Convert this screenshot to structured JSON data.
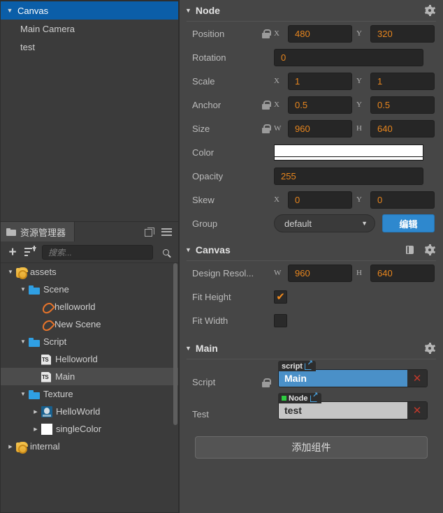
{
  "hierarchy": {
    "items": [
      {
        "label": "Canvas",
        "indent": 0,
        "arrow": "down",
        "selected": true
      },
      {
        "label": "Main Camera",
        "indent": 1,
        "arrow": "none",
        "selected": false
      },
      {
        "label": "test",
        "indent": 1,
        "arrow": "none",
        "selected": false
      }
    ]
  },
  "assets": {
    "tab_label": "资源管理器",
    "tab_icon": "folder-icon",
    "popout_icon": "popout-icon",
    "menu_icon": "hamburger-menu-icon",
    "add_label": "+",
    "sort_icon": "sort-icon",
    "search": {
      "placeholder": "搜索...",
      "value": ""
    },
    "search_icon": "search-icon",
    "tree": [
      {
        "label": "assets",
        "indent": 0,
        "arrow": "down",
        "icon": "assets-bag-icon",
        "selected": false
      },
      {
        "label": "Scene",
        "indent": 1,
        "arrow": "down",
        "icon": "folder-icon",
        "selected": false
      },
      {
        "label": "helloworld",
        "indent": 2,
        "arrow": "none",
        "icon": "scene-fire-icon",
        "selected": false
      },
      {
        "label": "New Scene",
        "indent": 2,
        "arrow": "none",
        "icon": "scene-fire-icon",
        "selected": false
      },
      {
        "label": "Script",
        "indent": 1,
        "arrow": "down",
        "icon": "folder-icon",
        "selected": false
      },
      {
        "label": "Helloworld",
        "indent": 2,
        "arrow": "none",
        "icon": "typescript-icon",
        "selected": false
      },
      {
        "label": "Main",
        "indent": 2,
        "arrow": "none",
        "icon": "typescript-icon",
        "selected": true
      },
      {
        "label": "Texture",
        "indent": 1,
        "arrow": "down",
        "icon": "folder-icon",
        "selected": false
      },
      {
        "label": "HelloWorld",
        "indent": 2,
        "arrow": "right",
        "icon": "texture-thumb-icon",
        "selected": false
      },
      {
        "label": "singleColor",
        "indent": 2,
        "arrow": "right",
        "icon": "white-thumb-icon",
        "selected": false
      },
      {
        "label": "internal",
        "indent": 0,
        "arrow": "right",
        "icon": "assets-bag-icon",
        "selected": false
      }
    ]
  },
  "inspector": {
    "node_section": {
      "title": "Node",
      "collapse_arrow": "▼",
      "gear_icon": "gear-icon",
      "rows": {
        "position": {
          "label": "Position",
          "locked": true,
          "x_axis": "X",
          "x": "480",
          "y_axis": "Y",
          "y": "320"
        },
        "rotation": {
          "label": "Rotation",
          "value": "0"
        },
        "scale": {
          "label": "Scale",
          "locked": false,
          "x_axis": "X",
          "x": "1",
          "y_axis": "Y",
          "y": "1"
        },
        "anchor": {
          "label": "Anchor",
          "locked": true,
          "x_axis": "X",
          "x": "0.5",
          "y_axis": "Y",
          "y": "0.5"
        },
        "size": {
          "label": "Size",
          "locked": true,
          "x_axis": "W",
          "x": "960",
          "y_axis": "H",
          "y": "640"
        },
        "color": {
          "label": "Color",
          "swatch": "#ffffff"
        },
        "opacity": {
          "label": "Opacity",
          "value": "255"
        },
        "skew": {
          "label": "Skew",
          "locked": false,
          "x_axis": "X",
          "x": "0",
          "y_axis": "Y",
          "y": "0"
        },
        "group": {
          "label": "Group",
          "selected": "default",
          "caret": "▼",
          "edit_label": "编辑"
        }
      }
    },
    "canvas_section": {
      "title": "Canvas",
      "collapse_arrow": "▼",
      "book_icon": "book-icon",
      "gear_icon": "gear-icon",
      "design_resolution": {
        "label": "Design Resol...",
        "w_axis": "W",
        "w": "960",
        "h_axis": "H",
        "h": "640"
      },
      "fit_height": {
        "label": "Fit Height",
        "checked": true
      },
      "fit_width": {
        "label": "Fit Width",
        "checked": false
      }
    },
    "main_section": {
      "title": "Main",
      "collapse_arrow": "▼",
      "gear_icon": "gear-icon",
      "script_row": {
        "label": "Script",
        "locked": true,
        "tag": "script",
        "tag_link_icon": "external-link-icon",
        "value": "Main",
        "clear_label": "✕"
      },
      "test_row": {
        "label": "Test",
        "locked": false,
        "tag": "Node",
        "tag_dot_color": "#2ecc40",
        "tag_link_icon": "external-link-icon",
        "value": "test",
        "clear_label": "✕"
      },
      "add_component_label": "添加组件"
    }
  },
  "colors": {
    "accent_orange": "#e8861e",
    "selection_blue": "#0b5ea8",
    "button_blue": "#2e88ce",
    "panel_bg": "#464646",
    "tree_bg": "#3b3b3b"
  }
}
